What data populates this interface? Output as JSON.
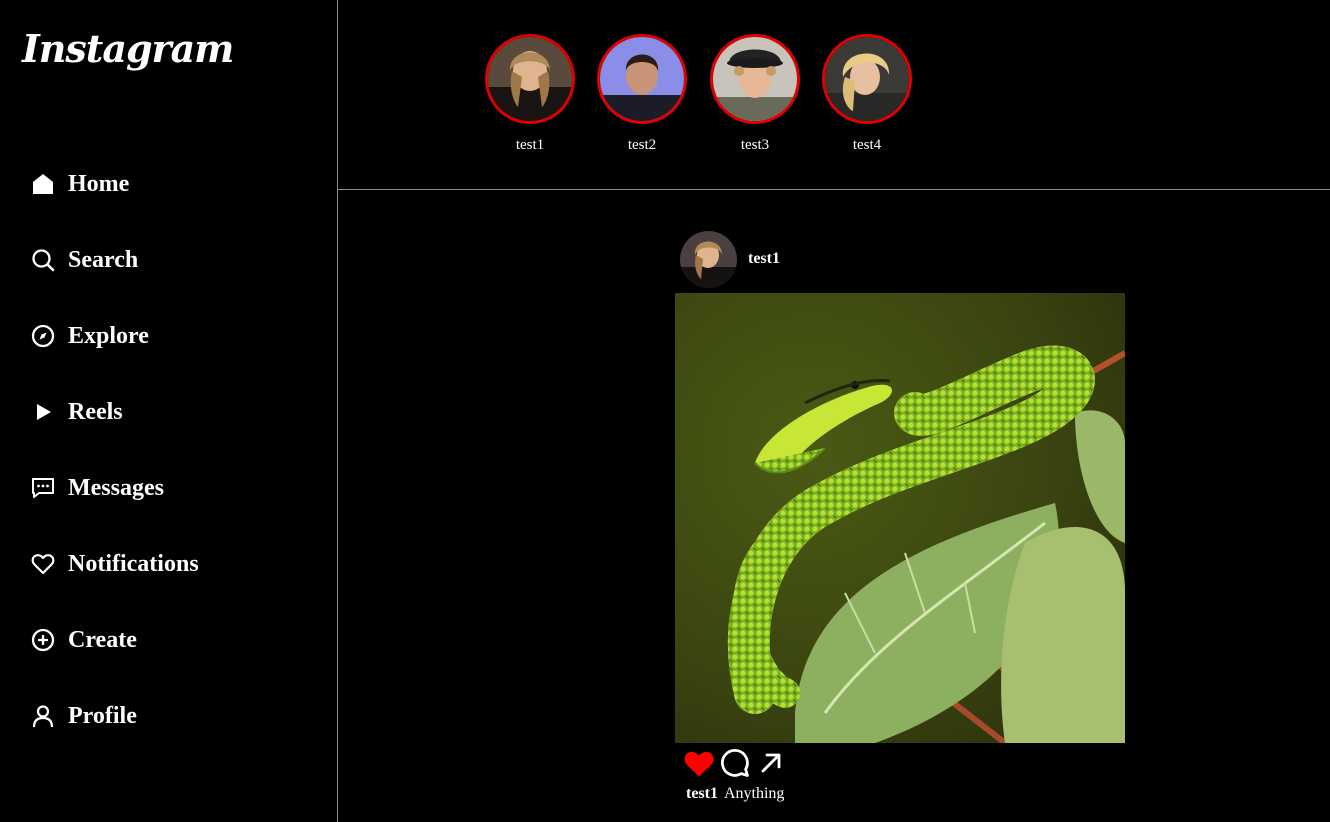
{
  "app": {
    "logo_text": "Instagram"
  },
  "sidebar": {
    "items": [
      {
        "label": "Home",
        "icon": "home-icon"
      },
      {
        "label": "Search",
        "icon": "search-icon"
      },
      {
        "label": "Explore",
        "icon": "compass-icon"
      },
      {
        "label": "Reels",
        "icon": "play-icon"
      },
      {
        "label": "Messages",
        "icon": "message-icon"
      },
      {
        "label": "Notifications",
        "icon": "heart-icon"
      },
      {
        "label": "Create",
        "icon": "plus-circle-icon"
      },
      {
        "label": "Profile",
        "icon": "user-icon"
      }
    ]
  },
  "stories": [
    {
      "name": "test1"
    },
    {
      "name": "test2"
    },
    {
      "name": "test3"
    },
    {
      "name": "test4"
    }
  ],
  "post": {
    "username": "test1",
    "caption_user": "test1",
    "caption_text": "Anything",
    "liked": true
  },
  "colors": {
    "background": "#000000",
    "story_ring": "#e10000",
    "like": "#ff0000",
    "divider": "#8a8a8a"
  }
}
